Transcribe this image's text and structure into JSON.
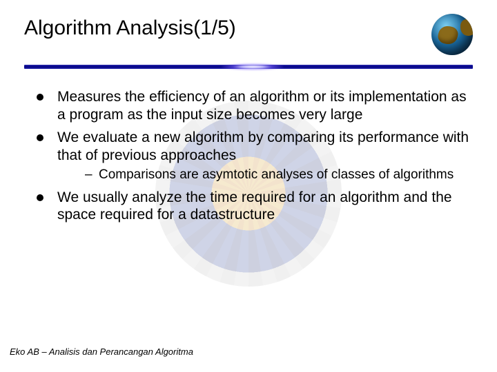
{
  "title": "Algorithm Analysis(1/5)",
  "bullets": {
    "b1": "Measures the efficiency of an algorithm or its implementation as a program as the input size becomes very large",
    "b2": "We evaluate a new algorithm by comparing its performance with that of previous approaches",
    "b2_sub1": "Comparisons are asymtotic analyses of classes of algorithms",
    "b3": "We usually analyze the time required for an algorithm and the space required for a datastructure"
  },
  "footer": "Eko AB – Analisis dan Perancangan Algoritma"
}
